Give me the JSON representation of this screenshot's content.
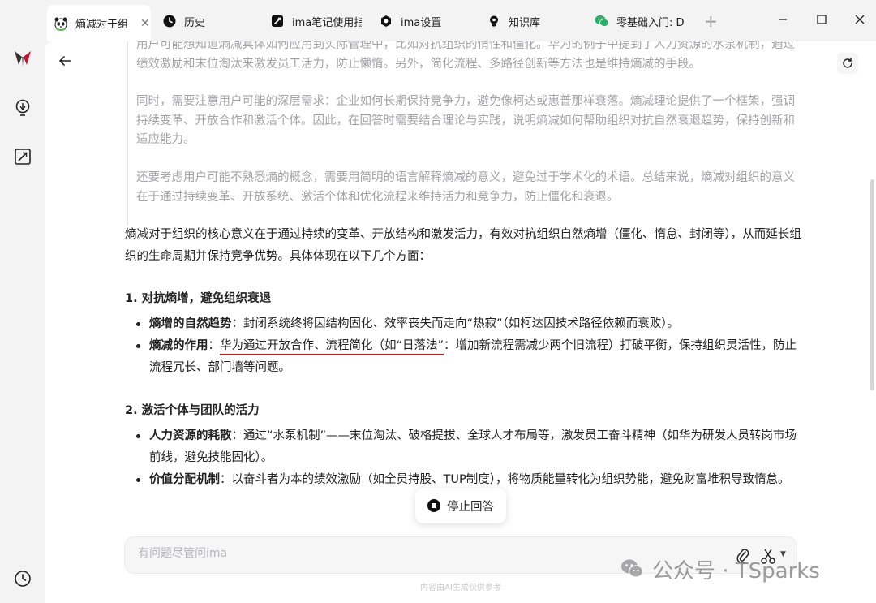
{
  "tabs": [
    {
      "label": "熵减对于组",
      "icon": "panda-icon",
      "active": true
    },
    {
      "label": "历史",
      "icon": "clock-icon"
    },
    {
      "label": "ima笔记使用指",
      "icon": "note-icon"
    },
    {
      "label": "ima设置",
      "icon": "settings-icon"
    },
    {
      "label": "知识库",
      "icon": "bulb-icon"
    },
    {
      "label": "零基础入门: D",
      "icon": "wechat-icon"
    }
  ],
  "new_tab": "+",
  "thinking": [
    "用户可能想知道熵减具体如何应用到实际管理中，比如对抗组织的惰性和僵化。华为的例子中提到了人力资源的水泵机制，通过绩效激励和末位淘汰来激发员工活力，防止懒惰。另外，简化流程、多路径创新等方法也是维持熵减的手段。",
    "同时，需要注意用户可能的深层需求：企业如何长期保持竞争力，避免像柯达或惠普那样衰落。熵减理论提供了一个框架，强调持续变革、开放合作和激活个体。因此，在回答时需要结合理论与实践，说明熵减如何帮助组织对抗自然衰退趋势，保持创新和适应能力。",
    "还要考虑用户可能不熟悉熵的概念，需要用简明的语言解释熵减的意义，避免过于学术化的术语。总结来说，熵减对组织的意义在于通过持续变革、开放系统、激活个体和优化流程来维持活力和竞争力，防止僵化和衰退。"
  ],
  "answer": {
    "intro": "熵减对于组织的核心意义在于通过持续的变革、开放结构和激发活力，有效对抗组织自然熵增（僵化、惰怠、封闭等），从而延长组织的生命周期并保持竞争优势。具体体现在以下几个方面：",
    "s1_title": "1. 对抗熵增，避免组织衰退",
    "s1_b1_bold": "熵增的自然趋势",
    "s1_b1_text": "：封闭系统终将因结构固化、效率丧失而走向“热寂”（如柯达因技术路径依赖而衰败）。",
    "s1_b2_bold": "熵减的作用",
    "s1_b2_colon": "：",
    "s1_b2_underlined": "华为通过开放合作、流程简化（如“日落法”",
    "s1_b2_rest": "：增加新流程需减少两个旧流程）打破平衡，保持组织灵活性，防止流程冗长、部门墙等问题。",
    "s2_title": "2. 激活个体与团队的活力",
    "s2_b1_bold": "人力资源的耗散",
    "s2_b1_text": "：通过“水泵机制”——末位淘汰、破格提拔、全球人才布局等，激发员工奋斗精神（如华为研发人员转岗市场前线，避免技能固化）。",
    "s2_b2_bold": "价值分配机制",
    "s2_b2_text": "：以奋斗者为本的绩效激励（如全员持股、TUP制度），将物质能量转化为组织势能，避免财富堆积导致惰怠。"
  },
  "stop_label": "停止回答",
  "input_placeholder": "有问题尽管问ima",
  "disclaimer": "内容由AI生成仅供参考",
  "watermark": "公众号 · TSparks",
  "colors": {
    "underline": "#b71c1c",
    "thinking_text": "#a3a3a7"
  }
}
